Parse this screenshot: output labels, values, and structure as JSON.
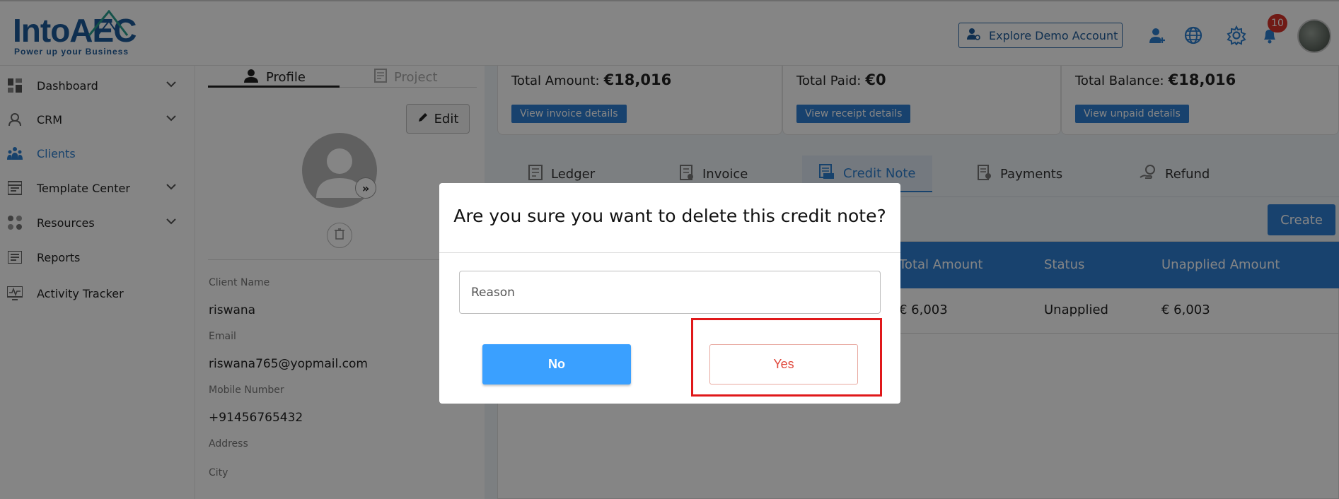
{
  "header": {
    "logo_text": "IntoAEC",
    "logo_tagline": "Power up your Business",
    "demo_button": "Explore Demo Account",
    "notification_count": "10"
  },
  "sidebar": {
    "items": [
      {
        "label": "Dashboard",
        "icon": "dashboard-icon"
      },
      {
        "label": "CRM",
        "icon": "crm-icon"
      },
      {
        "label": "Clients",
        "icon": "clients-icon"
      },
      {
        "label": "Template Center",
        "icon": "template-icon"
      },
      {
        "label": "Resources",
        "icon": "resources-icon"
      },
      {
        "label": "Reports",
        "icon": "reports-icon"
      },
      {
        "label": "Activity Tracker",
        "icon": "activity-icon"
      }
    ]
  },
  "profile": {
    "tabs": [
      "Profile",
      "Project"
    ],
    "edit_label": "Edit",
    "fields": [
      {
        "label": "Client Name",
        "value": "riswana"
      },
      {
        "label": "Email",
        "value": "riswana765@yopmail.com"
      },
      {
        "label": "Mobile Number",
        "value": "+91456765432"
      },
      {
        "label": "Address",
        "value": ""
      },
      {
        "label": "City",
        "value": ""
      }
    ]
  },
  "summary": {
    "cards": [
      {
        "label": "Total Amount:",
        "value": "€18,016",
        "button": "View invoice details"
      },
      {
        "label": "Total Paid:",
        "value": "€0",
        "button": "View receipt details"
      },
      {
        "label": "Total Balance:",
        "value": "€18,016",
        "button": "View unpaid details"
      }
    ]
  },
  "tabs": [
    "Ledger",
    "Invoice",
    "Credit Note",
    "Payments",
    "Refund"
  ],
  "create_label": "Create",
  "table": {
    "headers": [
      "Total Amount",
      "Status",
      "Unapplied Amount"
    ],
    "rows": [
      {
        "total": "€ 6,003",
        "status": "Unapplied",
        "unapplied": "€ 6,003"
      }
    ]
  },
  "modal": {
    "title": "Are you sure you want to delete this credit note?",
    "reason_placeholder": "Reason",
    "no_label": "No",
    "yes_label": "Yes"
  },
  "colors": {
    "primary": "#2f7fd4",
    "no_button": "#3aa0ff",
    "yes_text": "#e0483c",
    "highlight": "#e0181a",
    "badge": "#d7322a"
  }
}
